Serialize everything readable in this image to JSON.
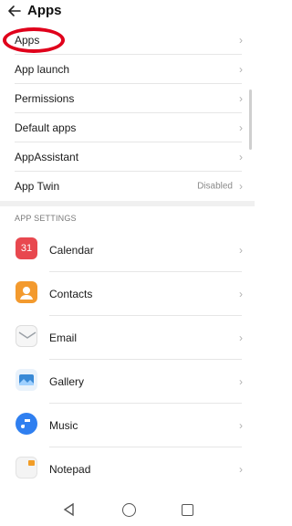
{
  "header": {
    "back_icon": "arrow-left-icon",
    "title": "Apps"
  },
  "menu": [
    {
      "label": "Apps",
      "value": ""
    },
    {
      "label": "App launch",
      "value": ""
    },
    {
      "label": "Permissions",
      "value": ""
    },
    {
      "label": "Default apps",
      "value": ""
    },
    {
      "label": "AppAssistant",
      "value": ""
    },
    {
      "label": "App Twin",
      "value": "Disabled"
    }
  ],
  "section": {
    "title": "APP SETTINGS"
  },
  "apps": [
    {
      "label": "Calendar",
      "icon": "calendar-icon",
      "icon_text": "31",
      "color": "#e8484f"
    },
    {
      "label": "Contacts",
      "icon": "contacts-icon",
      "icon_text": "",
      "color": "#f39a2e"
    },
    {
      "label": "Email",
      "icon": "email-icon",
      "icon_text": "",
      "color": "#9aa0a6"
    },
    {
      "label": "Gallery",
      "icon": "gallery-icon",
      "icon_text": "",
      "color": "#3a8ad6"
    },
    {
      "label": "Music",
      "icon": "music-icon",
      "icon_text": "",
      "color": "#2f7ff0"
    },
    {
      "label": "Notepad",
      "icon": "notepad-icon",
      "icon_text": "",
      "color": "#f29d27"
    }
  ],
  "colors": {
    "highlight": "#e0001b",
    "chevron": "#b0b0b0"
  }
}
